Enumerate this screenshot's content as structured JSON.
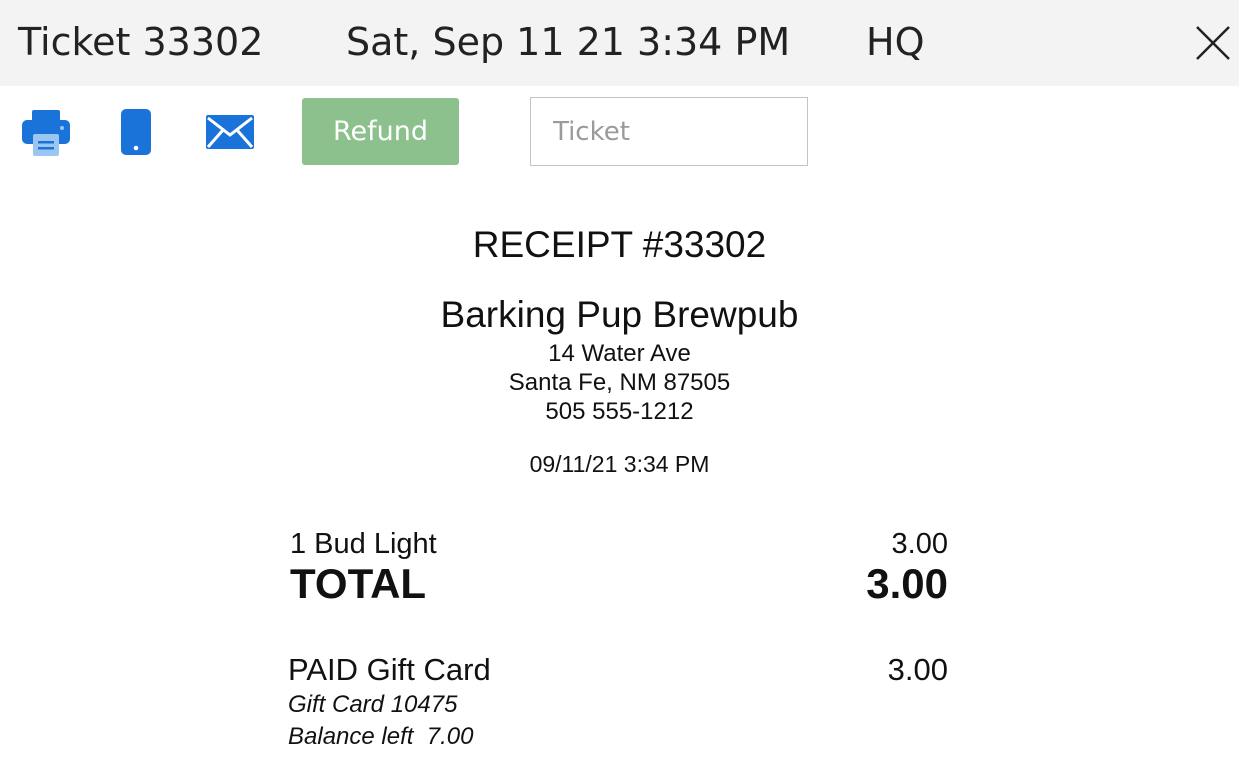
{
  "header": {
    "ticket_title": "Ticket 33302",
    "datetime": "Sat, Sep 11 21 3:34 PM",
    "location": "HQ"
  },
  "toolbar": {
    "icons": [
      "printer-icon",
      "phone-icon",
      "email-icon"
    ],
    "refund_label": "Refund",
    "ticket_placeholder": "Ticket",
    "ticket_value": ""
  },
  "receipt": {
    "title": "RECEIPT #33302",
    "business_name": "Barking Pup Brewpub",
    "address_line1": "14 Water Ave",
    "address_line2": "Santa Fe, NM  87505",
    "phone": "505 555-1212",
    "datetime": "09/11/21 3:34 PM",
    "items": [
      {
        "label": "1 Bud Light",
        "amount": "3.00"
      }
    ],
    "total_label": "TOTAL",
    "total_amount": "3.00",
    "payment": {
      "label": "PAID Gift Card",
      "amount": "3.00",
      "card_line": "Gift Card 10475",
      "balance_line": "Balance left  7.00"
    }
  },
  "colors": {
    "header_bg": "#f3f3f3",
    "icon_blue": "#1a73d9",
    "refund_bg": "#8cc08c"
  }
}
